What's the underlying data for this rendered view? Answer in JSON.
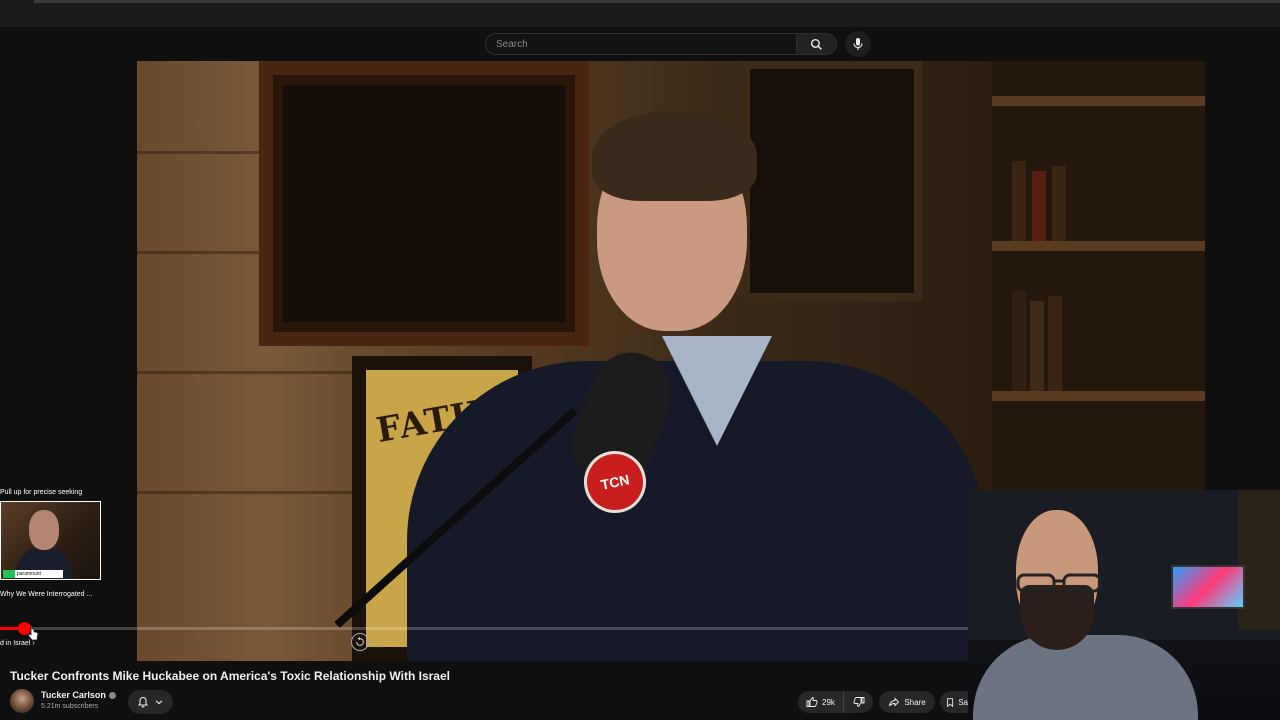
{
  "search": {
    "placeholder": "Search"
  },
  "player": {
    "progress_fraction": 0.025,
    "seek_hint": "Pull up for precise seeking",
    "seek_preview_title": "Why We Were Interrogated ...",
    "chapter_label": "d in Israel",
    "logo_text": "TCN",
    "poster_text": "FATIM",
    "icons": {
      "autoplay": "autoplay-icon",
      "cursor": "cursor-icon",
      "chapter_next": "chevron-right-icon"
    }
  },
  "video": {
    "title": "Tucker Confronts Mike Huckabee on America's Toxic Relationship With Israel",
    "channel": {
      "name": "Tucker Carlson",
      "subscribers": "5.21m subscribers"
    }
  },
  "actions": {
    "like_count": "29k",
    "share_label": "Share",
    "save_label": "Sa"
  },
  "colors": {
    "accent": "#ff0000",
    "background": "#0f0f0f",
    "button_bg": "#272727"
  }
}
